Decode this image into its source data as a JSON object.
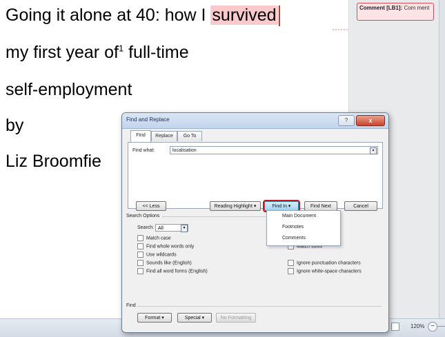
{
  "document": {
    "line1_prefix": "Going it alone at 40: how I ",
    "line1_highlight": "survived",
    "line2_text": "my first year of",
    "line2_sup": "1",
    "line2_suffix": " full-time",
    "line3": "self-employment",
    "line4": "by",
    "line5": "Liz Broomfie"
  },
  "comment": {
    "label": "Comment [LB1]:",
    "text": "Com ment"
  },
  "statusbar": {
    "zoom": "120%",
    "zoom_minus": "−"
  },
  "dialog": {
    "title": "Find and Replace",
    "help": "?",
    "close": "x",
    "tabs": [
      "Find",
      "Replace",
      "Go To"
    ],
    "find_what_label": "Find what:",
    "find_what_value": "localisation",
    "buttons": {
      "less": "<< Less",
      "reading_highlight": "Reading Highlight ▾",
      "find_in": "Find In ▾",
      "find_next": "Find Next",
      "cancel": "Cancel",
      "format": "Format ▾",
      "special": "Special ▾",
      "no_formatting": "No Formatting"
    },
    "search_options_label": "Search Options",
    "search_label": "Search:",
    "search_value": "All",
    "options_left": [
      "Match case",
      "Find whole words only",
      "Use wildcards",
      "Sounds like (English)",
      "Find all word forms (English)"
    ],
    "options_right": [
      "Match suffix",
      "Ignore punctuation characters",
      "Ignore white-space characters"
    ],
    "find_section_label": "Find",
    "find_in_menu": [
      "Main Document",
      "Footnotes",
      "Comments"
    ]
  }
}
